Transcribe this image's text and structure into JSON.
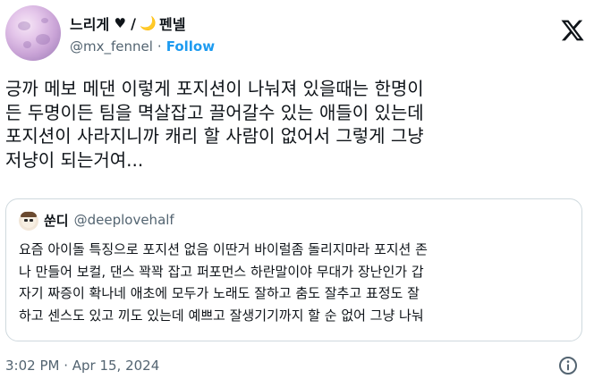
{
  "author": {
    "name_part1": "느리게",
    "heart_glyph": "♥",
    "separator": "/",
    "moon_glyph": "🌙",
    "name_part2": "펜넬",
    "handle": "@mx_fennel",
    "dot": "·",
    "follow_label": "Follow"
  },
  "tweet": {
    "lines": [
      "긍까 메보 메댄 이렇게 포지션이 나눠져 있을때는 한명이",
      "든 두명이든 팀을 멱살잡고 끌어갈수 있는 애들이 있는데",
      "포지션이 사라지니까 캐리 할 사람이 없어서 그렇게 그냥",
      "저냥이 되는거여..."
    ]
  },
  "quote": {
    "name": "쑨디",
    "handle": "@deeplovehalf",
    "lines": [
      "요즘 아이돌 특징으로 포지션 없음 이딴거 바이럴좀 돌리지마라 포지션 존",
      "나 만들어 보컬, 댄스 꽉꽉 잡고 퍼포먼스 하란말이야 무대가 장난인가 갑",
      "자기 짜증이 확나네 애초에 모두가 노래도 잘하고 춤도 잘추고 표정도 잘",
      "하고 센스도 있고 끼도 있는데 예쁘고 잘생기기까지 할 순 없어 그냥 나눠"
    ]
  },
  "footer": {
    "timestamp": "3:02 PM · Apr 15, 2024"
  },
  "colors": {
    "accent": "#1d9bf0",
    "secondary_text": "#536471",
    "border": "#cfd9de"
  }
}
